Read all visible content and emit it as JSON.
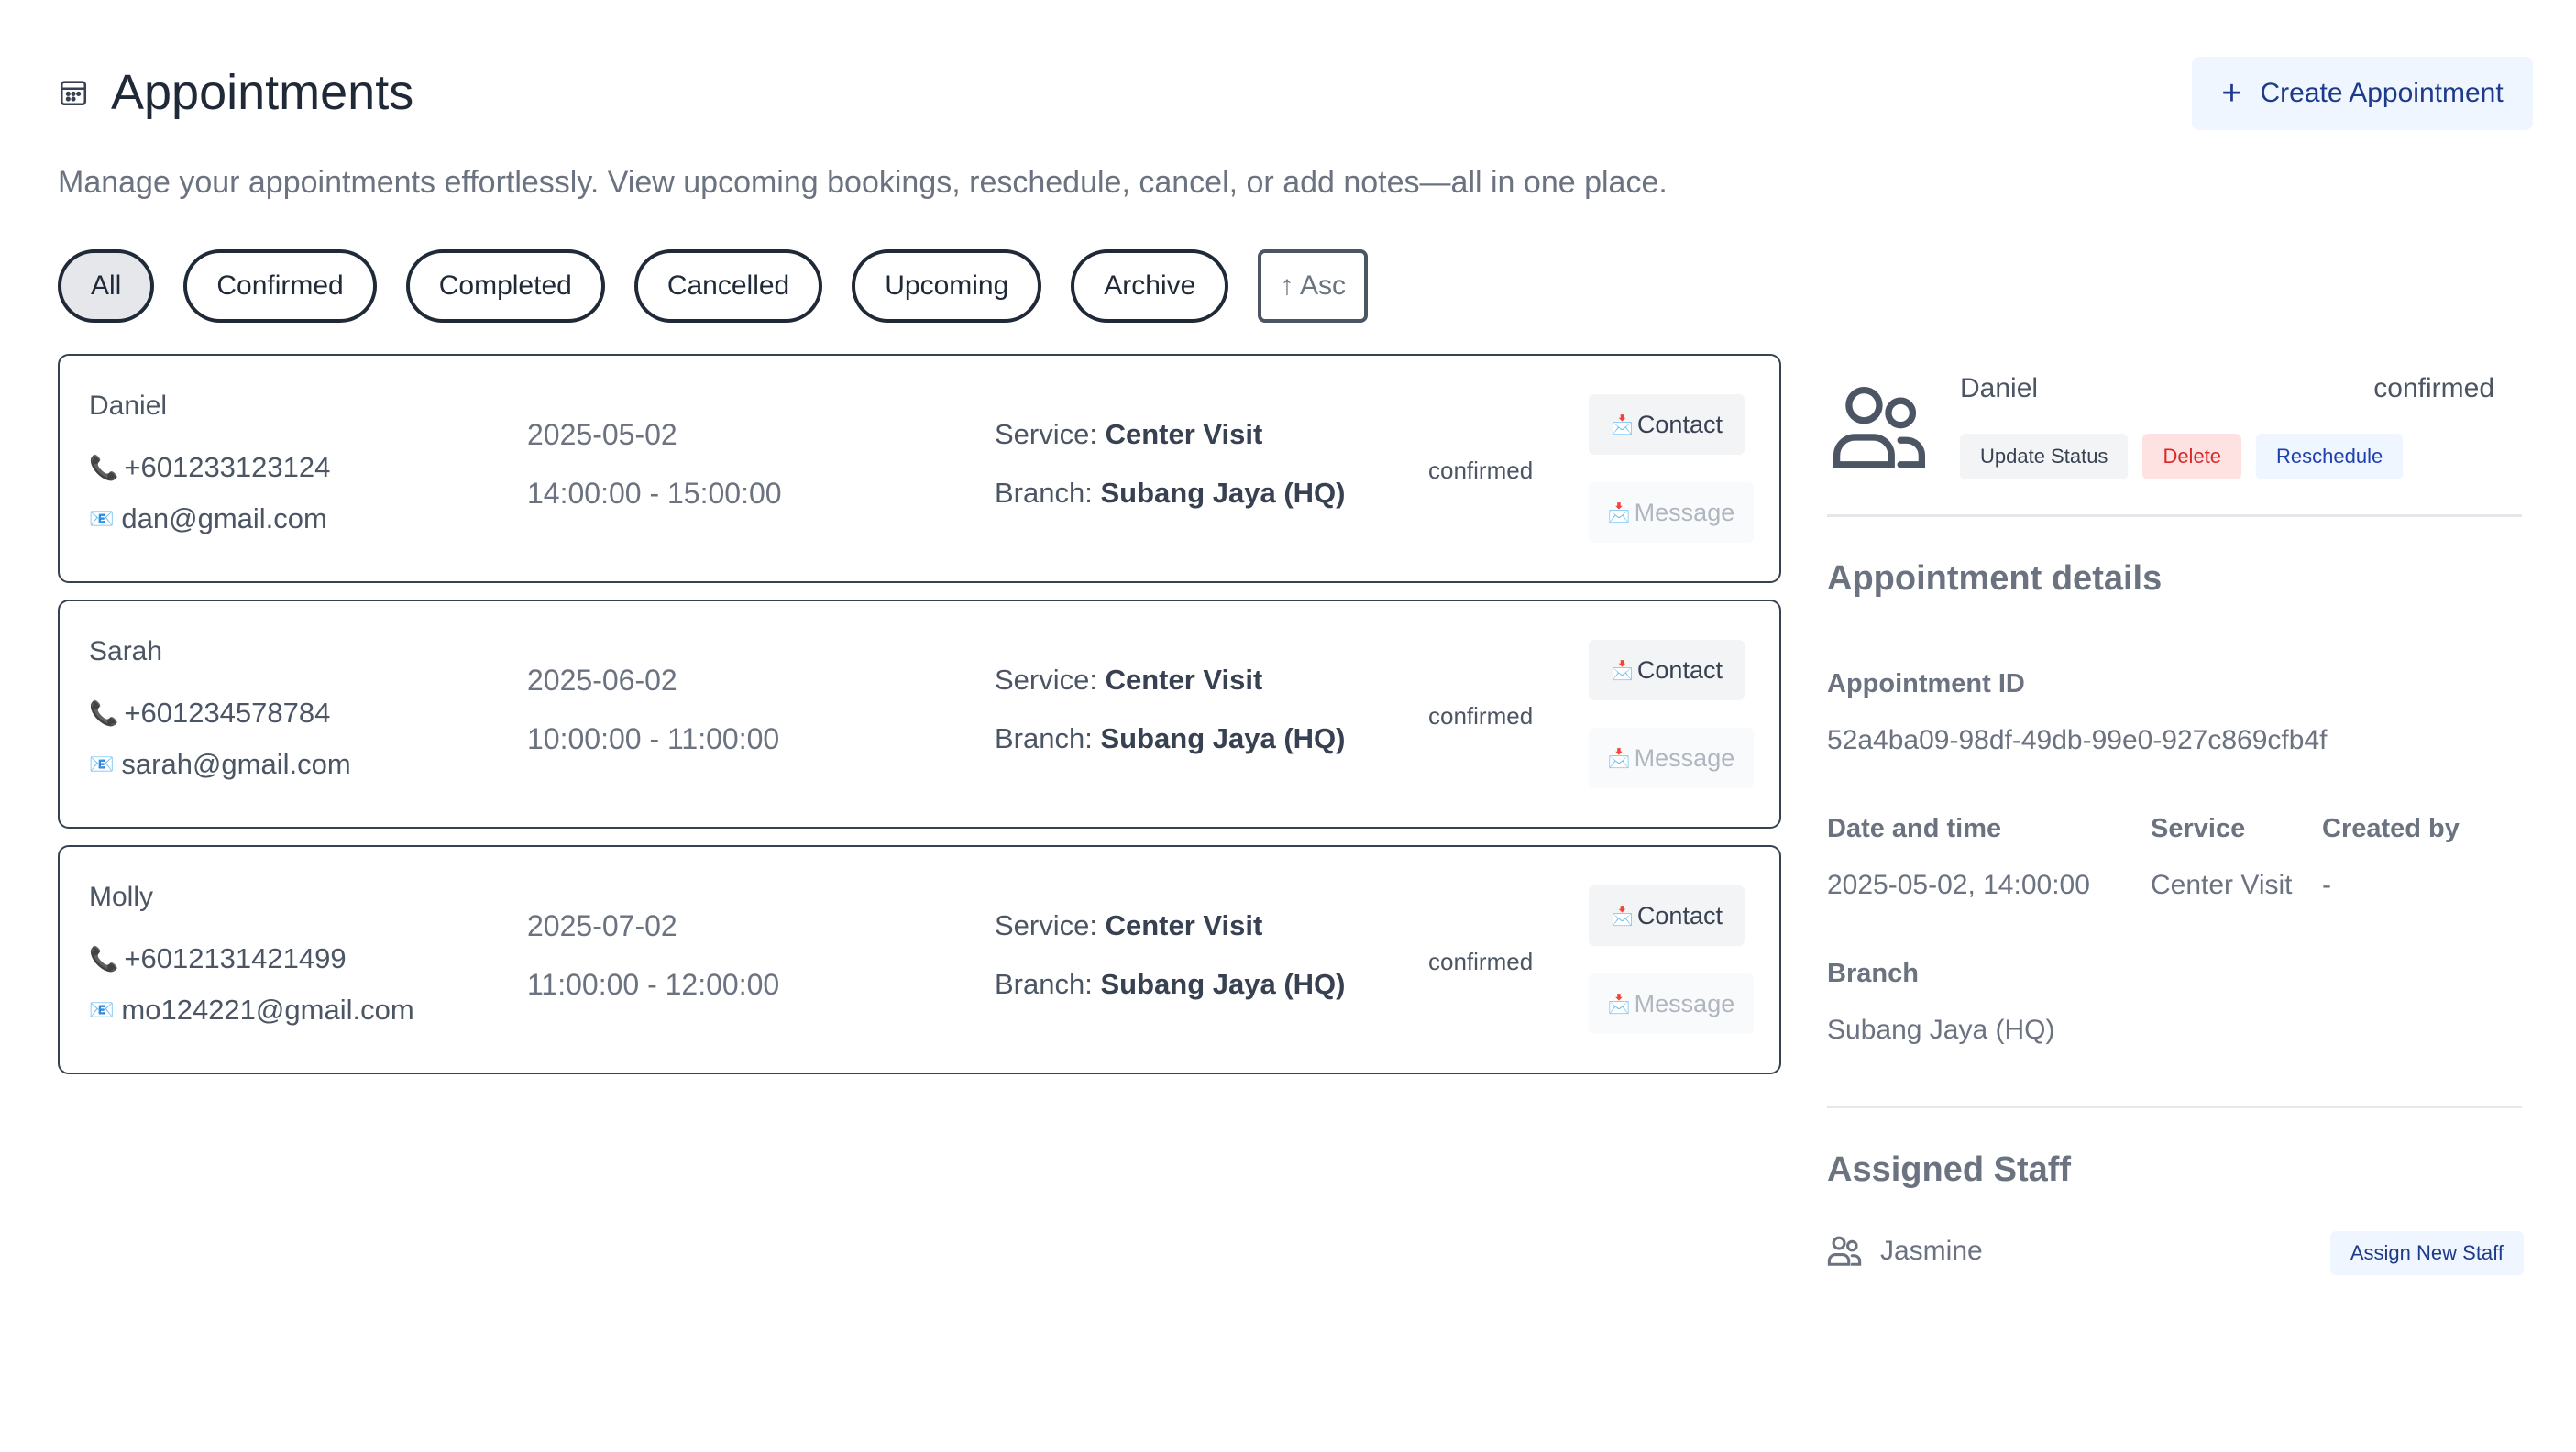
{
  "header": {
    "title": "Appointments",
    "title_icon": "calendar-icon",
    "create_button": {
      "icon": "plus-icon",
      "label": "Create Appointment"
    },
    "subtitle": "Manage your appointments effortlessly. View upcoming bookings, reschedule, cancel, or add notes—all in one place."
  },
  "filters": {
    "tabs": [
      "All",
      "Confirmed",
      "Completed",
      "Cancelled",
      "Upcoming",
      "Archive"
    ],
    "active": "All",
    "sort_label": "↑ Asc"
  },
  "appointments": [
    {
      "name": "Daniel",
      "phone": "+601233123124",
      "email": "dan@gmail.com",
      "date": "2025-05-02",
      "time": "14:00:00 - 15:00:00",
      "service_label": "Service:",
      "service": "Center Visit",
      "branch_label": "Branch:",
      "branch": "Subang Jaya (HQ)",
      "status": "confirmed",
      "contact_label": "Contact",
      "message_label": "Message"
    },
    {
      "name": "Sarah",
      "phone": "+601234578784",
      "email": "sarah@gmail.com",
      "date": "2025-06-02",
      "time": "10:00:00 - 11:00:00",
      "service_label": "Service:",
      "service": "Center Visit",
      "branch_label": "Branch:",
      "branch": "Subang Jaya (HQ)",
      "status": "confirmed",
      "contact_label": "Contact",
      "message_label": "Message"
    },
    {
      "name": "Molly",
      "phone": "+6012131421499",
      "email": "mo124221@gmail.com",
      "date": "2025-07-02",
      "time": "11:00:00 - 12:00:00",
      "service_label": "Service:",
      "service": "Center Visit",
      "branch_label": "Branch:",
      "branch": "Subang Jaya (HQ)",
      "status": "confirmed",
      "contact_label": "Contact",
      "message_label": "Message"
    }
  ],
  "detail": {
    "name": "Daniel",
    "status": "confirmed",
    "actions": {
      "update": "Update Status",
      "delete": "Delete",
      "reschedule": "Reschedule"
    },
    "section_title": "Appointment details",
    "id_label": "Appointment ID",
    "id_value": "52a4ba09-98df-49db-99e0-927c869cfb4f",
    "datetime_label": "Date and time",
    "datetime_value": "2025-05-02, 14:00:00",
    "service_label": "Service",
    "service_value": "Center Visit",
    "created_label": "Created by",
    "created_value": "-",
    "branch_label": "Branch",
    "branch_value": "Subang Jaya (HQ)",
    "staff_title": "Assigned Staff",
    "staff_name": "Jasmine",
    "assign_label": "Assign New Staff"
  },
  "colors": {
    "accent_blue_bg": "#eff6ff",
    "accent_blue_text": "#1e3a8a",
    "delete_bg": "#fee2e2",
    "delete_text": "#dc2626"
  }
}
